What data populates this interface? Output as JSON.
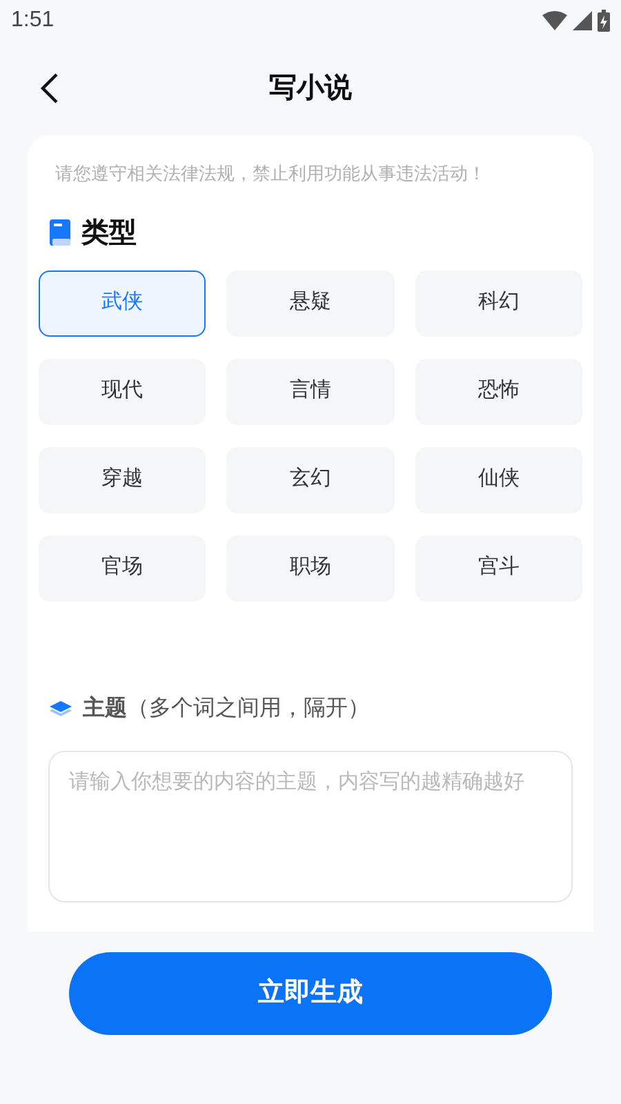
{
  "status_bar": {
    "time": "1:51"
  },
  "header": {
    "title": "写小说"
  },
  "notice": "请您遵守相关法律法规，禁止利用功能从事违法活动！",
  "genre_section": {
    "title": "类型",
    "options": [
      {
        "label": "武侠",
        "selected": true
      },
      {
        "label": "悬疑",
        "selected": false
      },
      {
        "label": "科幻",
        "selected": false
      },
      {
        "label": "现代",
        "selected": false
      },
      {
        "label": "言情",
        "selected": false
      },
      {
        "label": "恐怖",
        "selected": false
      },
      {
        "label": "穿越",
        "selected": false
      },
      {
        "label": "玄幻",
        "selected": false
      },
      {
        "label": "仙侠",
        "selected": false
      },
      {
        "label": "官场",
        "selected": false
      },
      {
        "label": "职场",
        "selected": false
      },
      {
        "label": "宫斗",
        "selected": false
      }
    ]
  },
  "theme_section": {
    "label": "**主题**（多个词之间用，隔开）",
    "placeholder": "请输入你想要的内容的主题，内容写的越精确越好"
  },
  "generate_button": "立即生成"
}
